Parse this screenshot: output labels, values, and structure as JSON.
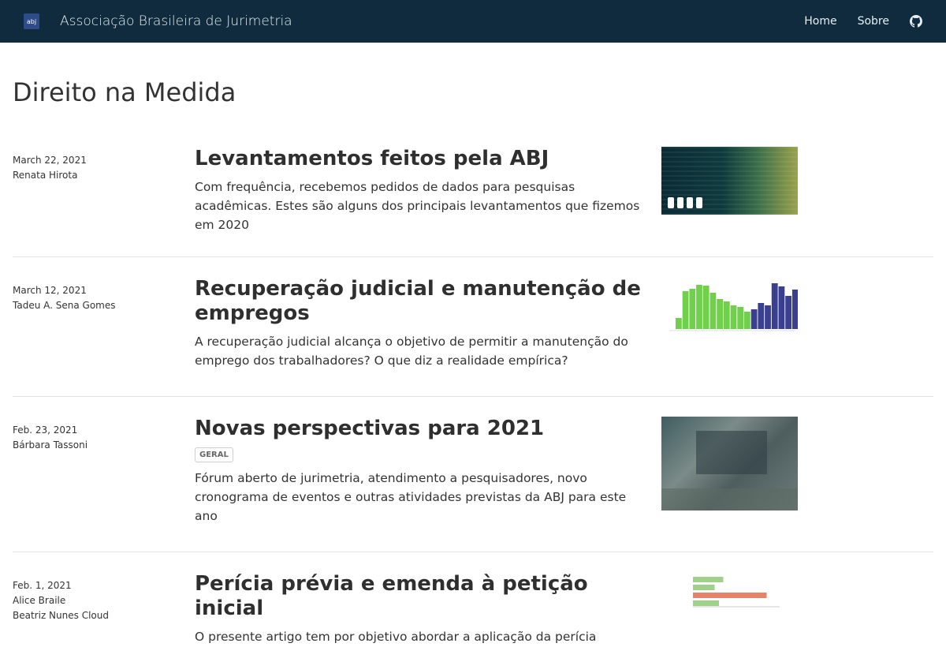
{
  "header": {
    "logo_text": "abj",
    "site_title": "Associação Brasileira de Jurimetria",
    "nav": {
      "home": "Home",
      "about": "Sobre"
    },
    "github_icon": "github-icon",
    "colors": {
      "bg": "#0f2b3d"
    }
  },
  "page": {
    "title": "Direito na Medida"
  },
  "posts": [
    {
      "date": "March 22, 2021",
      "authors": [
        "Renata Hirota"
      ],
      "title": "Levantamentos feitos pela ABJ",
      "excerpt": "Com frequência, recebemos pedidos de dados para pesquisas acadêmicas. Estes são alguns dos principais levantamentos que fizemos em 2020"
    },
    {
      "date": "March 12, 2021",
      "authors": [
        "Tadeu A. Sena Gomes"
      ],
      "title": "Recuperação judicial e manutenção de empregos",
      "excerpt": "A recuperação judicial alcança o objetivo de permitir a manutenção do emprego dos trabalhadores? O que diz a realidade empírica?"
    },
    {
      "date": "Feb. 23, 2021",
      "authors": [
        "Bárbara Tassoni"
      ],
      "title": "Novas perspectivas para 2021",
      "tag": "GERAL",
      "excerpt": "Fórum aberto de jurimetria, atendimento a pesquisadores, novo cronograma de eventos e outras atividades previstas da ABJ para este ano"
    },
    {
      "date": "Feb. 1, 2021",
      "authors": [
        "Alice Braile",
        "Beatriz Nunes Cloud"
      ],
      "title": "Perícia prévia e emenda à petição inicial",
      "excerpt": "O presente artigo tem por objetivo abordar a aplicação da perícia"
    }
  ],
  "thumbnails": {
    "post2_bars": {
      "green": [
        14,
        48,
        51,
        56,
        55,
        46,
        38,
        35,
        30,
        28,
        22
      ],
      "blue": [
        25,
        33,
        30,
        58,
        54,
        42,
        50
      ]
    },
    "post4_bars": [
      0.35,
      0.25,
      0.85,
      0.3
    ]
  }
}
